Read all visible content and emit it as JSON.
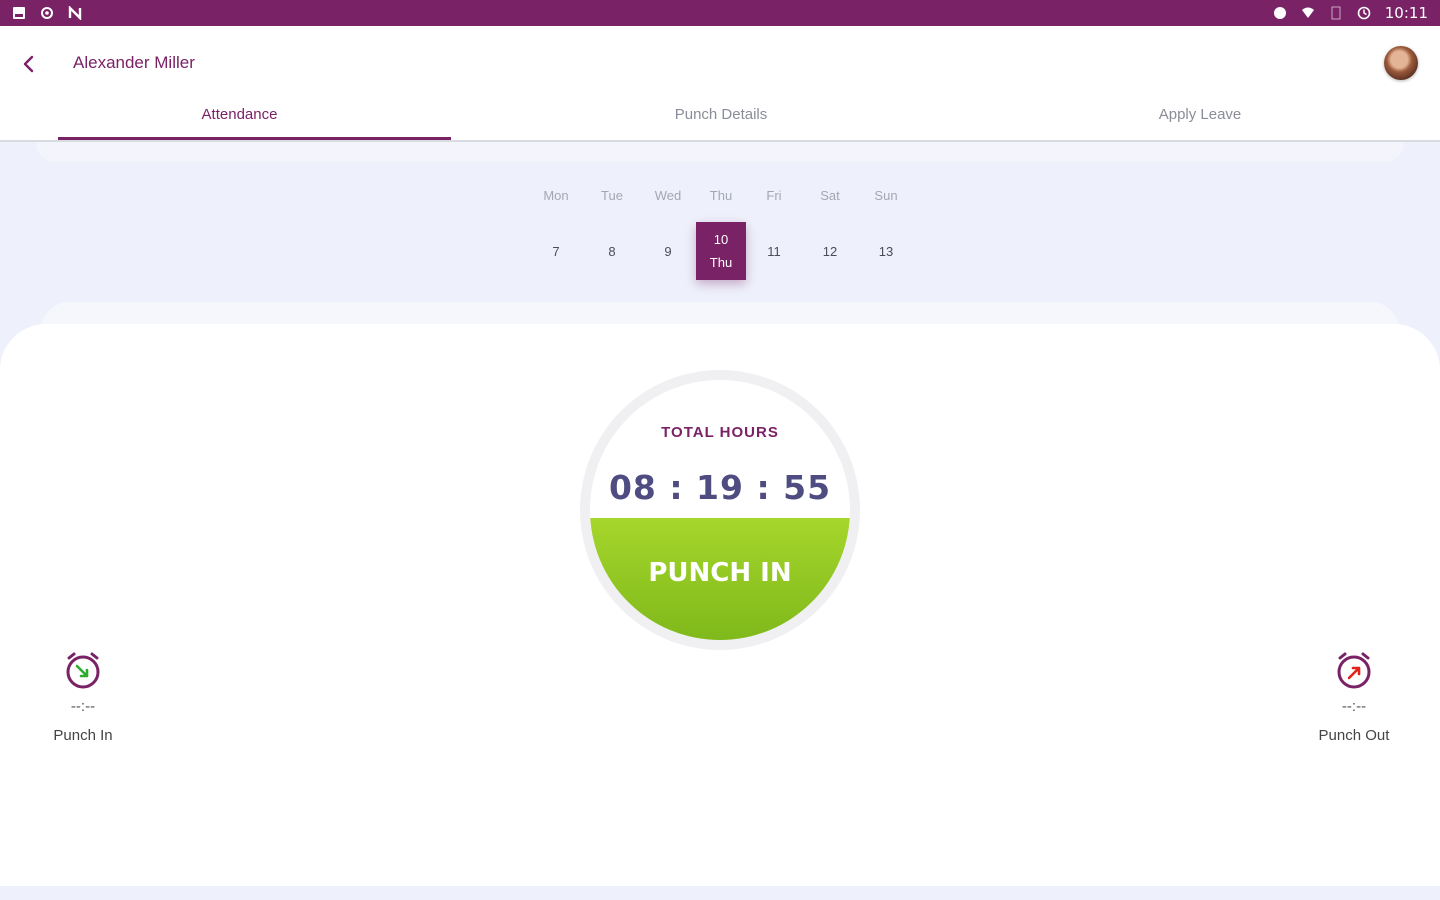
{
  "status_bar": {
    "time": "10:11"
  },
  "header": {
    "user_name": "Alexander Miller"
  },
  "tabs": [
    {
      "label": "Attendance",
      "active": true
    },
    {
      "label": "Punch Details",
      "active": false
    },
    {
      "label": "Apply Leave",
      "active": false
    }
  ],
  "calendar": {
    "weekdays": [
      "Mon",
      "Tue",
      "Wed",
      "Thu",
      "Fri",
      "Sat",
      "Sun"
    ],
    "dates": [
      "7",
      "8",
      "9",
      "10",
      "11",
      "12",
      "13"
    ],
    "selected": {
      "day": "10",
      "weekday": "Thu"
    }
  },
  "clock": {
    "label": "TOTAL HOURS",
    "time": "08 : 19 : 55",
    "button_label": "PUNCH IN"
  },
  "punch_in": {
    "time": "--:--",
    "label": "Punch In"
  },
  "punch_out": {
    "time": "--:--",
    "label": "Punch Out"
  },
  "colors": {
    "brand": "#7a2266",
    "punch_button": "#8cc11f",
    "timer": "#4e4c80"
  }
}
